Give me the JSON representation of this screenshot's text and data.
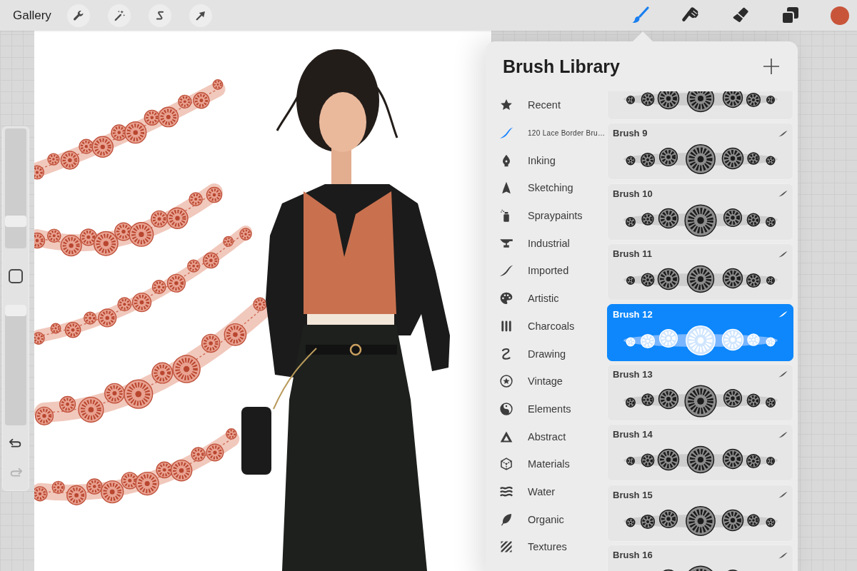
{
  "toolbar": {
    "gallery_label": "Gallery",
    "left_tools": [
      {
        "kind": "wrench"
      },
      {
        "kind": "wand"
      },
      {
        "kind": "selection"
      },
      {
        "kind": "arrow"
      }
    ],
    "right_tools": [
      {
        "kind": "brush",
        "selected": true
      },
      {
        "kind": "smudge",
        "selected": false
      },
      {
        "kind": "eraser",
        "selected": false
      },
      {
        "kind": "layers",
        "selected": false
      }
    ],
    "color_button": {
      "color": "#c8553a"
    }
  },
  "sidebar": {
    "brush_size": {
      "level": 0.2
    },
    "opacity": {
      "level": 1
    },
    "undo": {
      "disabled": false
    },
    "redo": {
      "disabled": true
    }
  },
  "brush_library": {
    "title": "Brush Library",
    "categories": [
      {
        "label": "Recent",
        "kind": "star",
        "selected": false
      },
      {
        "label": "120 Lace Border Bru…",
        "kind": "set",
        "selected": true
      },
      {
        "label": "Inking",
        "kind": "pen-nib",
        "selected": false
      },
      {
        "label": "Sketching",
        "kind": "sketch",
        "selected": false
      },
      {
        "label": "Spraypaints",
        "kind": "spray",
        "selected": false
      },
      {
        "label": "Industrial",
        "kind": "anvil",
        "selected": false
      },
      {
        "label": "Imported",
        "kind": "swoosh",
        "selected": false
      },
      {
        "label": "Artistic",
        "kind": "palette",
        "selected": false
      },
      {
        "label": "Charcoals",
        "kind": "bars",
        "selected": false
      },
      {
        "label": "Drawing",
        "kind": "squiggle",
        "selected": false
      },
      {
        "label": "Vintage",
        "kind": "circle-star",
        "selected": false
      },
      {
        "label": "Elements",
        "kind": "yin-yang",
        "selected": false
      },
      {
        "label": "Abstract",
        "kind": "triangle",
        "selected": false
      },
      {
        "label": "Materials",
        "kind": "cube",
        "selected": false
      },
      {
        "label": "Water",
        "kind": "waves",
        "selected": false
      },
      {
        "label": "Organic",
        "kind": "leaf",
        "selected": false
      },
      {
        "label": "Textures",
        "kind": "hatch",
        "selected": false
      }
    ],
    "brushes": [
      {
        "selected": false
      },
      {
        "name": "Brush 9",
        "selected": false
      },
      {
        "name": "Brush 10",
        "selected": false
      },
      {
        "name": "Brush 11",
        "selected": false
      },
      {
        "name": "Brush 12",
        "selected": true
      },
      {
        "name": "Brush 13",
        "selected": false
      },
      {
        "name": "Brush 14",
        "selected": false
      },
      {
        "name": "Brush 15",
        "selected": false
      },
      {
        "name": "Brush 16",
        "selected": false
      }
    ]
  }
}
